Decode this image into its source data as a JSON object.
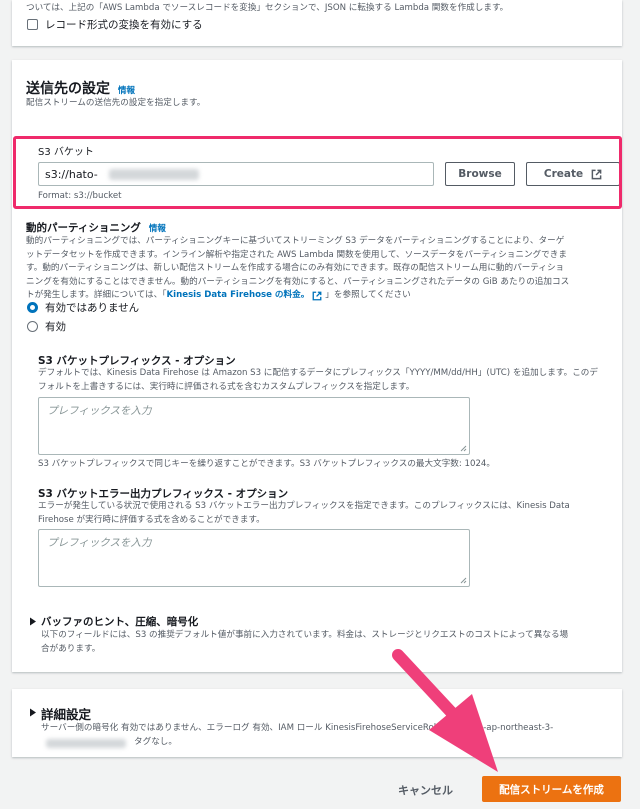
{
  "top_section": {
    "note_text": "ついては、上記の「AWS Lambda でソースレコードを変換」セクションで、JSON に転換する Lambda 関数を作成します。",
    "record_format_checkbox_label": "レコード形式の変換を有効にする"
  },
  "destination": {
    "title": "送信先の設定",
    "info_link": "情報",
    "description": "配信ストリームの送信先の設定を指定します。",
    "s3_bucket": {
      "label": "S3 バケット",
      "value": "s3://hato-",
      "format_hint": "Format: s3://bucket",
      "browse_label": "Browse",
      "create_label": "Create"
    },
    "dynamic_partitioning": {
      "title": "動的パーティショニング",
      "info_link": "情報",
      "desc_lines": [
        "動的パーティショニングでは、パーティショニングキーに基づいてストリーミング S3 データをパーティショニングすることにより、ターゲ",
        "ットデータセットを作成できます。インライン解析や指定された AWS Lambda 関数を使用して、ソースデータをパーティショニングできま",
        "す。動的パーティショニングは、新しい配信ストリームを作成する場合にのみ有効にできます。既存の配信ストリーム用に動的パーティショ",
        "ニングを有効にすることはできません。動的パーティショニングを有効にすると、パーティショニングされたデータの GiB あたりの追加コス"
      ],
      "desc_last_prefix": "トが発生します。詳細については、「",
      "desc_link": "Kinesis Data Firehose の料金。",
      "desc_last_suffix": "」を参照してください",
      "options": [
        "有効ではありません",
        "有効"
      ],
      "selected": "有効ではありません"
    },
    "prefix": {
      "title": "S3 バケットプレフィックス - オプション",
      "desc_lines": [
        "デフォルトでは、Kinesis Data Firehose は Amazon S3 に配信するデータにプレフィックス「YYYY/MM/dd/HH」(UTC) を追加します。このデ",
        "フォルトを上書きするには、実行時に評価される式を含むカスタムプレフィックスを指定します。"
      ],
      "placeholder": "プレフィックスを入力",
      "helper": "S3 バケットプレフィックスで同じキーを繰り返すことができます。S3 バケットプレフィックスの最大文字数: 1024。"
    },
    "error_prefix": {
      "title": "S3 バケットエラー出力プレフィックス - オプション",
      "desc_lines": [
        "エラーが発生している状況で使用される S3 バケットエラー出力プレフィックスを指定できます。このプレフィックスには、Kinesis Data",
        "Firehose が実行時に評価する式を含めることができます。"
      ],
      "placeholder": "プレフィックスを入力"
    },
    "buffer": {
      "title": "バッファのヒント、圧縮、暗号化",
      "desc_lines": [
        "以下のフィールドには、S3 の推奨デフォルト値が事前に入力されています。料金は、ストレージとリクエストのコストによって異なる場",
        "合があります。"
      ]
    }
  },
  "advanced": {
    "title": "詳細設定",
    "summary_line1": "サーバー側の暗号化 有効ではありません、エラーログ 有効、IAM ロール KinesisFirehoseServiceRol",
    "summary_line1_tail": "on-a-ap-northeast-3-",
    "summary_line2": "タグなし。"
  },
  "footer": {
    "cancel_label": "キャンセル",
    "create_label": "配信ストリームを作成"
  },
  "colors": {
    "highlight_border": "#ef2a6b",
    "arrow": "#ef3f7a",
    "link": "#0073bb",
    "primary": "#ec7211"
  }
}
